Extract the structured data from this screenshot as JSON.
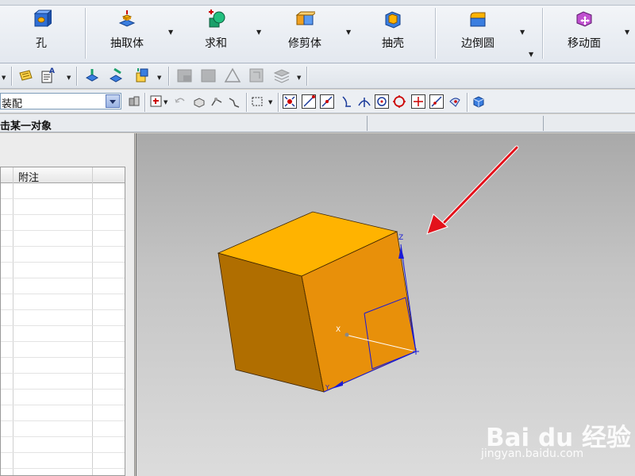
{
  "ribbon": {
    "buttons": [
      {
        "label": "孔",
        "icon": "hole-icon"
      },
      {
        "label": "抽取体",
        "icon": "extract-body-icon"
      },
      {
        "label": "求和",
        "icon": "unite-icon"
      },
      {
        "label": "修剪体",
        "icon": "trim-body-icon"
      },
      {
        "label": "抽壳",
        "icon": "shell-icon"
      },
      {
        "label": "边倒圆",
        "icon": "edge-blend-icon"
      },
      {
        "label": "移动面",
        "icon": "move-face-icon"
      }
    ]
  },
  "toolbar3": {
    "filter_combo_value": "装配"
  },
  "status": {
    "prompt": "击某一对象"
  },
  "navigator": {
    "columns": [
      "附注"
    ],
    "row_count": 18
  },
  "watermark": {
    "logo": "Bai du 经验",
    "url": "jingyan.baidu.com"
  },
  "colors": {
    "cube_top": "#ffb300",
    "cube_front": "#e8900a",
    "cube_left": "#b06e00",
    "arrow": "#e3121b",
    "csys": "#1a1ad6"
  }
}
